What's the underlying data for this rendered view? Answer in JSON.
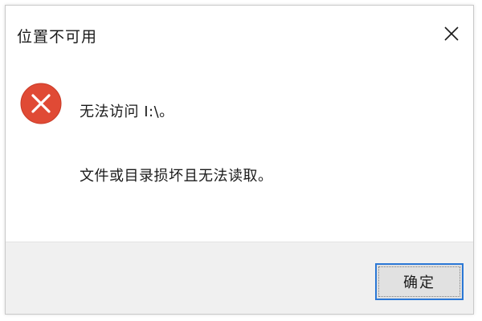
{
  "window": {
    "title": "位置不可用"
  },
  "icons": {
    "close": "close-icon",
    "error": "error-icon"
  },
  "message": {
    "line1": "无法访问 I:\\。",
    "line2": "文件或目录损坏且无法读取。"
  },
  "buttons": {
    "ok_label": "确定"
  },
  "colors": {
    "error_red": "#e04a35",
    "focus_blue": "#2b78d6",
    "footer_bg": "#f0f0f0"
  }
}
